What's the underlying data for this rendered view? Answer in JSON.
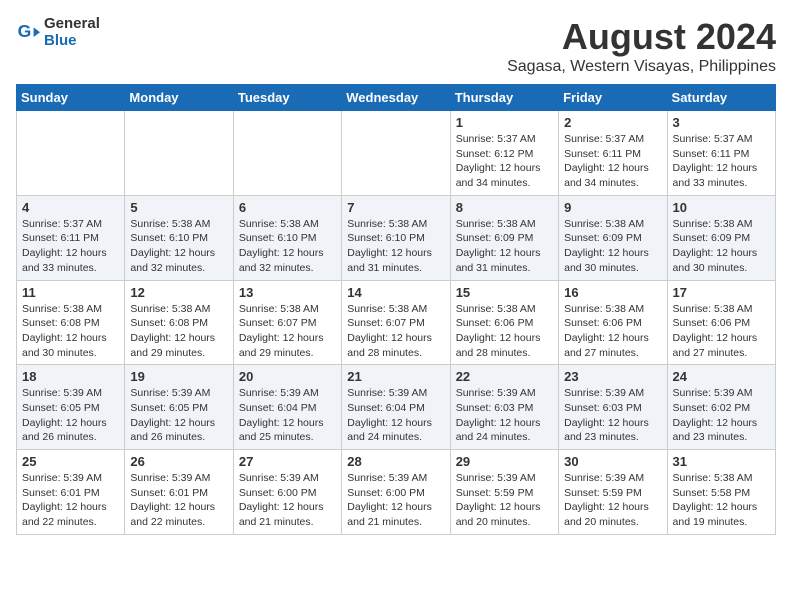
{
  "logo": {
    "general": "General",
    "blue": "Blue"
  },
  "title": "August 2024",
  "subtitle": "Sagasa, Western Visayas, Philippines",
  "days_of_week": [
    "Sunday",
    "Monday",
    "Tuesday",
    "Wednesday",
    "Thursday",
    "Friday",
    "Saturday"
  ],
  "weeks": [
    [
      {
        "day": "",
        "info": ""
      },
      {
        "day": "",
        "info": ""
      },
      {
        "day": "",
        "info": ""
      },
      {
        "day": "",
        "info": ""
      },
      {
        "day": "1",
        "info": "Sunrise: 5:37 AM\nSunset: 6:12 PM\nDaylight: 12 hours\nand 34 minutes."
      },
      {
        "day": "2",
        "info": "Sunrise: 5:37 AM\nSunset: 6:11 PM\nDaylight: 12 hours\nand 34 minutes."
      },
      {
        "day": "3",
        "info": "Sunrise: 5:37 AM\nSunset: 6:11 PM\nDaylight: 12 hours\nand 33 minutes."
      }
    ],
    [
      {
        "day": "4",
        "info": "Sunrise: 5:37 AM\nSunset: 6:11 PM\nDaylight: 12 hours\nand 33 minutes."
      },
      {
        "day": "5",
        "info": "Sunrise: 5:38 AM\nSunset: 6:10 PM\nDaylight: 12 hours\nand 32 minutes."
      },
      {
        "day": "6",
        "info": "Sunrise: 5:38 AM\nSunset: 6:10 PM\nDaylight: 12 hours\nand 32 minutes."
      },
      {
        "day": "7",
        "info": "Sunrise: 5:38 AM\nSunset: 6:10 PM\nDaylight: 12 hours\nand 31 minutes."
      },
      {
        "day": "8",
        "info": "Sunrise: 5:38 AM\nSunset: 6:09 PM\nDaylight: 12 hours\nand 31 minutes."
      },
      {
        "day": "9",
        "info": "Sunrise: 5:38 AM\nSunset: 6:09 PM\nDaylight: 12 hours\nand 30 minutes."
      },
      {
        "day": "10",
        "info": "Sunrise: 5:38 AM\nSunset: 6:09 PM\nDaylight: 12 hours\nand 30 minutes."
      }
    ],
    [
      {
        "day": "11",
        "info": "Sunrise: 5:38 AM\nSunset: 6:08 PM\nDaylight: 12 hours\nand 30 minutes."
      },
      {
        "day": "12",
        "info": "Sunrise: 5:38 AM\nSunset: 6:08 PM\nDaylight: 12 hours\nand 29 minutes."
      },
      {
        "day": "13",
        "info": "Sunrise: 5:38 AM\nSunset: 6:07 PM\nDaylight: 12 hours\nand 29 minutes."
      },
      {
        "day": "14",
        "info": "Sunrise: 5:38 AM\nSunset: 6:07 PM\nDaylight: 12 hours\nand 28 minutes."
      },
      {
        "day": "15",
        "info": "Sunrise: 5:38 AM\nSunset: 6:06 PM\nDaylight: 12 hours\nand 28 minutes."
      },
      {
        "day": "16",
        "info": "Sunrise: 5:38 AM\nSunset: 6:06 PM\nDaylight: 12 hours\nand 27 minutes."
      },
      {
        "day": "17",
        "info": "Sunrise: 5:38 AM\nSunset: 6:06 PM\nDaylight: 12 hours\nand 27 minutes."
      }
    ],
    [
      {
        "day": "18",
        "info": "Sunrise: 5:39 AM\nSunset: 6:05 PM\nDaylight: 12 hours\nand 26 minutes."
      },
      {
        "day": "19",
        "info": "Sunrise: 5:39 AM\nSunset: 6:05 PM\nDaylight: 12 hours\nand 26 minutes."
      },
      {
        "day": "20",
        "info": "Sunrise: 5:39 AM\nSunset: 6:04 PM\nDaylight: 12 hours\nand 25 minutes."
      },
      {
        "day": "21",
        "info": "Sunrise: 5:39 AM\nSunset: 6:04 PM\nDaylight: 12 hours\nand 24 minutes."
      },
      {
        "day": "22",
        "info": "Sunrise: 5:39 AM\nSunset: 6:03 PM\nDaylight: 12 hours\nand 24 minutes."
      },
      {
        "day": "23",
        "info": "Sunrise: 5:39 AM\nSunset: 6:03 PM\nDaylight: 12 hours\nand 23 minutes."
      },
      {
        "day": "24",
        "info": "Sunrise: 5:39 AM\nSunset: 6:02 PM\nDaylight: 12 hours\nand 23 minutes."
      }
    ],
    [
      {
        "day": "25",
        "info": "Sunrise: 5:39 AM\nSunset: 6:01 PM\nDaylight: 12 hours\nand 22 minutes."
      },
      {
        "day": "26",
        "info": "Sunrise: 5:39 AM\nSunset: 6:01 PM\nDaylight: 12 hours\nand 22 minutes."
      },
      {
        "day": "27",
        "info": "Sunrise: 5:39 AM\nSunset: 6:00 PM\nDaylight: 12 hours\nand 21 minutes."
      },
      {
        "day": "28",
        "info": "Sunrise: 5:39 AM\nSunset: 6:00 PM\nDaylight: 12 hours\nand 21 minutes."
      },
      {
        "day": "29",
        "info": "Sunrise: 5:39 AM\nSunset: 5:59 PM\nDaylight: 12 hours\nand 20 minutes."
      },
      {
        "day": "30",
        "info": "Sunrise: 5:39 AM\nSunset: 5:59 PM\nDaylight: 12 hours\nand 20 minutes."
      },
      {
        "day": "31",
        "info": "Sunrise: 5:38 AM\nSunset: 5:58 PM\nDaylight: 12 hours\nand 19 minutes."
      }
    ]
  ]
}
